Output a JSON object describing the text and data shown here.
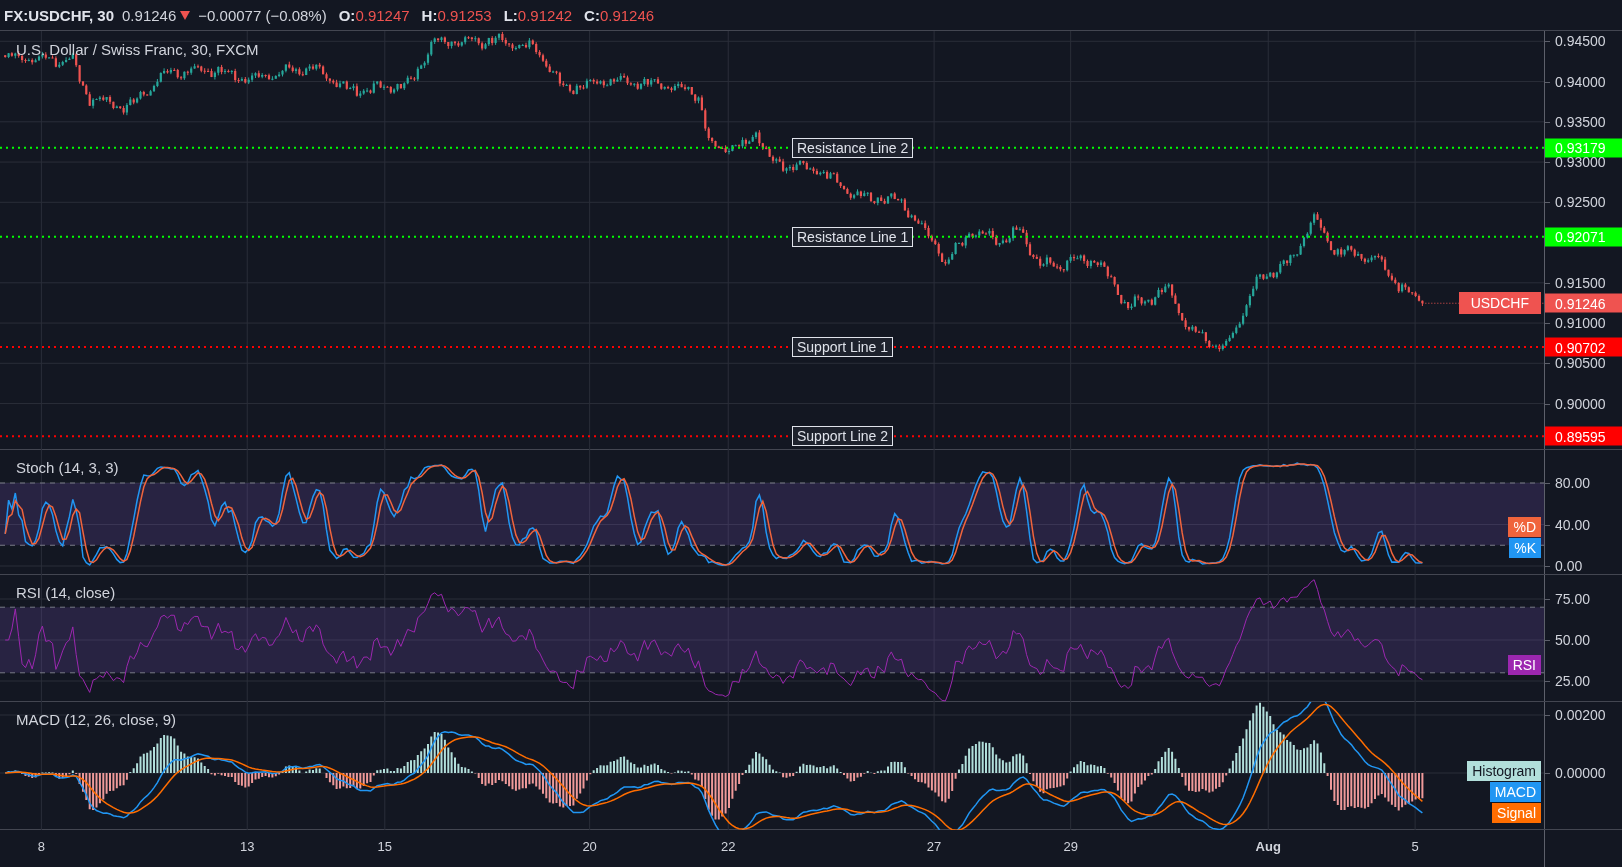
{
  "header": {
    "symbol": "FX:USDCHF, 30",
    "last": "0.91246",
    "change": "−0.00077 (−0.08%)",
    "ohlc": [
      {
        "label": "O:",
        "value": "0.91247"
      },
      {
        "label": "H:",
        "value": "0.91253"
      },
      {
        "label": "L:",
        "value": "0.91242"
      },
      {
        "label": "C:",
        "value": "0.91246"
      }
    ]
  },
  "price_pane": {
    "title": "U.S. Dollar / Swiss Franc, 30, FXCM",
    "ticks": [
      "0.94500",
      "0.94000",
      "0.93500",
      "0.93000",
      "0.92500",
      "0.91500",
      "0.91000",
      "0.90500",
      "0.90000"
    ],
    "levels": [
      {
        "label": "Resistance Line 2",
        "value": "0.93179",
        "color": "#00ff00"
      },
      {
        "label": "Resistance Line 1",
        "value": "0.92071",
        "color": "#00ff00"
      },
      {
        "label": "Support Line 1",
        "value": "0.90702",
        "color": "#ff0000"
      },
      {
        "label": "Support Line 2",
        "value": "0.89595",
        "color": "#ff0000"
      }
    ],
    "last_price": {
      "label": "USDCHF",
      "value": "0.91246"
    }
  },
  "indicators": [
    {
      "kind": "stoch",
      "title": "Stoch (14, 3, 3)",
      "ticks": [
        "80.00",
        "40.00",
        "0.00"
      ],
      "legend": [
        {
          "label": "%D",
          "color": "#f0643c"
        },
        {
          "label": "%K",
          "color": "#2196f3"
        }
      ]
    },
    {
      "kind": "rsi",
      "title": "RSI (14, close)",
      "ticks": [
        "75.00",
        "50.00",
        "25.00"
      ],
      "legend": [
        {
          "label": "RSI",
          "color": "#9c27b0"
        }
      ]
    },
    {
      "kind": "macd",
      "title": "MACD (12, 26, close, 9)",
      "ticks": [
        "0.00200",
        "0.00000"
      ],
      "legend": [
        {
          "label": "Histogram",
          "color": "#b2dfdb"
        },
        {
          "label": "MACD",
          "color": "#2196f3"
        },
        {
          "label": "Signal",
          "color": "#ff6d00"
        }
      ]
    }
  ],
  "time_axis": [
    {
      "label": "8",
      "bold": false
    },
    {
      "label": "13",
      "bold": false
    },
    {
      "label": "15",
      "bold": false
    },
    {
      "label": "20",
      "bold": false
    },
    {
      "label": "22",
      "bold": false
    },
    {
      "label": "27",
      "bold": false
    },
    {
      "label": "29",
      "bold": false
    },
    {
      "label": "Aug",
      "bold": true
    },
    {
      "label": "5",
      "bold": false
    }
  ]
}
